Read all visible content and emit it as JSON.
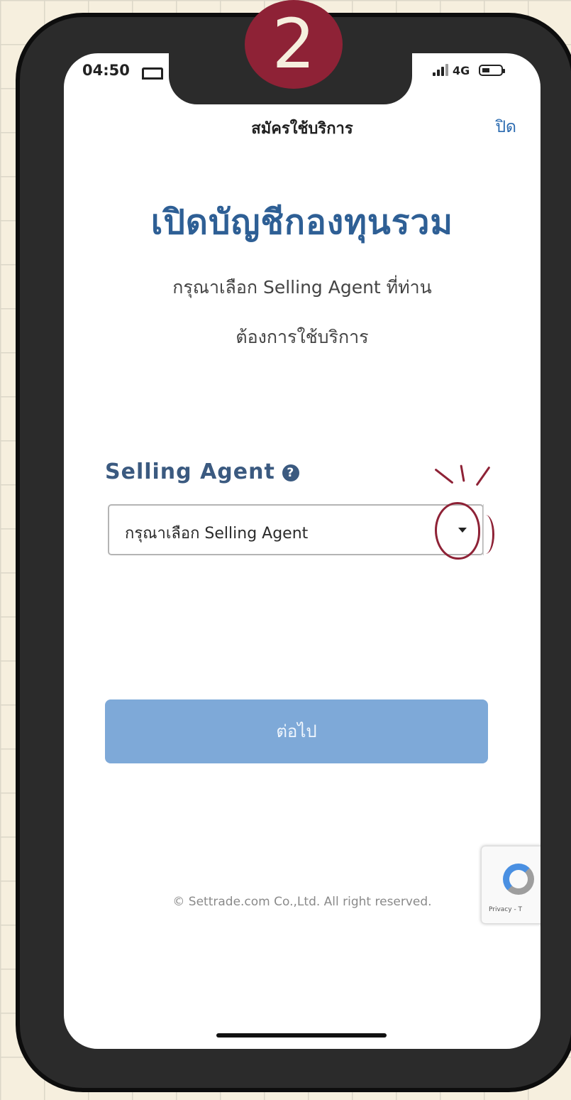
{
  "status_bar": {
    "time": "04:50",
    "network": "4G"
  },
  "nav": {
    "title": "สมัครใช้บริการ",
    "close_label": "ปิด"
  },
  "main": {
    "heading": "เปิดบัญชีกองทุนรวม",
    "subtitle_line1": "กรุณาเลือก Selling Agent ที่ท่าน",
    "subtitle_line2": "ต้องการใช้บริการ"
  },
  "form": {
    "field_label": "Selling Agent",
    "select_placeholder": "กรุณาเลือก Selling Agent",
    "next_label": "ต่อไป"
  },
  "recaptcha": {
    "text": "Privacy - T"
  },
  "footer": {
    "copyright": "© Settrade.com Co.,Ltd. All right reserved."
  },
  "annotation": {
    "step": "2"
  },
  "colors": {
    "heading": "#2e5f95",
    "button": "#7ea9d8",
    "annotation": "#8e2236"
  },
  "icons": [
    "help-icon",
    "chevron-down-icon",
    "recaptcha-icon",
    "bed-icon",
    "signal-icon",
    "battery-icon"
  ]
}
